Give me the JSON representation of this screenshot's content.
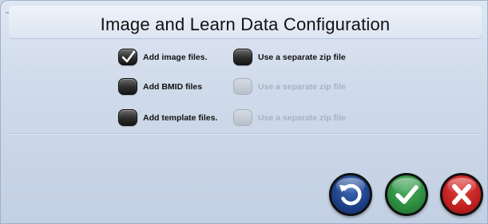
{
  "dialog": {
    "title": "Image and Learn Data Configuration"
  },
  "options": {
    "add_image": {
      "label": "Add image files.",
      "checked": true
    },
    "add_bmid": {
      "label": "Add BMID files",
      "checked": false
    },
    "add_template": {
      "label": "Add template files.",
      "checked": false
    },
    "zip_image": {
      "label": "Use a separate zip file",
      "checked": false,
      "enabled": true
    },
    "zip_bmid": {
      "label": "Use a separate zip file",
      "checked": false,
      "enabled": false
    },
    "zip_template": {
      "label": "Use a separate zip file",
      "checked": false,
      "enabled": false
    }
  },
  "buttons": {
    "reset": {
      "icon": "reset-icon",
      "color": "#1d3f86"
    },
    "ok": {
      "icon": "checkmark-icon",
      "color": "#2b8a3e"
    },
    "cancel": {
      "icon": "x-icon",
      "color": "#c0201f"
    }
  }
}
